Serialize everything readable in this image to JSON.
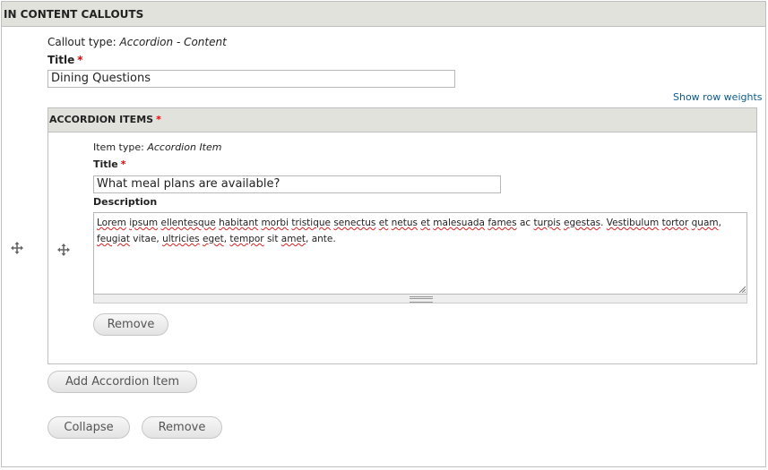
{
  "section": {
    "title": "In Content Callouts",
    "callout_type_label": "Callout type:",
    "callout_type_value": "Accordion - Content",
    "title_label": "Title",
    "required_marker": "*",
    "title_value": "Dining Questions",
    "show_row_weights": "Show row weights"
  },
  "accordion": {
    "header": "Accordion items",
    "required_marker": "*",
    "item": {
      "item_type_label": "Item type:",
      "item_type_value": "Accordion Item",
      "title_label": "Title",
      "required_marker": "*",
      "title_value": "What meal plans are available?",
      "description_label": "Description",
      "description_words": [
        {
          "t": "Lorem",
          "spell": true
        },
        {
          "t": " "
        },
        {
          "t": "ipsum",
          "spell": true
        },
        {
          "t": " "
        },
        {
          "t": "ellentesque",
          "spell": true
        },
        {
          "t": " "
        },
        {
          "t": "habitant",
          "spell": true
        },
        {
          "t": " "
        },
        {
          "t": "morbi",
          "spell": true
        },
        {
          "t": " "
        },
        {
          "t": "tristique",
          "spell": true
        },
        {
          "t": " "
        },
        {
          "t": "senectus",
          "spell": true
        },
        {
          "t": " "
        },
        {
          "t": "et",
          "spell": true
        },
        {
          "t": " "
        },
        {
          "t": "netus",
          "spell": true
        },
        {
          "t": " "
        },
        {
          "t": "et",
          "spell": true
        },
        {
          "t": " "
        },
        {
          "t": "malesuada",
          "spell": true
        },
        {
          "t": " "
        },
        {
          "t": "fames",
          "spell": true
        },
        {
          "t": " ac "
        },
        {
          "t": "turpis",
          "spell": true
        },
        {
          "t": " "
        },
        {
          "t": "egestas",
          "spell": true
        },
        {
          "t": ". "
        },
        {
          "t": "Vestibulum",
          "spell": true
        },
        {
          "t": " "
        },
        {
          "t": "tortor",
          "spell": true
        },
        {
          "t": " "
        },
        {
          "t": "quam",
          "spell": true
        },
        {
          "t": ", "
        },
        {
          "t": "feugiat",
          "spell": true
        },
        {
          "t": " vitae, "
        },
        {
          "t": "ultricies",
          "spell": true
        },
        {
          "t": " "
        },
        {
          "t": "eget",
          "spell": true
        },
        {
          "t": ", "
        },
        {
          "t": "tempor",
          "spell": true
        },
        {
          "t": " sit "
        },
        {
          "t": "amet",
          "spell": true
        },
        {
          "t": ", ante."
        }
      ],
      "remove_button": "Remove"
    }
  },
  "buttons": {
    "add_accordion_item": "Add Accordion Item",
    "collapse": "Collapse",
    "remove": "Remove"
  },
  "colors": {
    "header_bg": "#e1e2dc",
    "required": "#ee0000",
    "link": "#0a5b91"
  },
  "icons": {
    "drag_handle": "move-cross-arrows"
  }
}
